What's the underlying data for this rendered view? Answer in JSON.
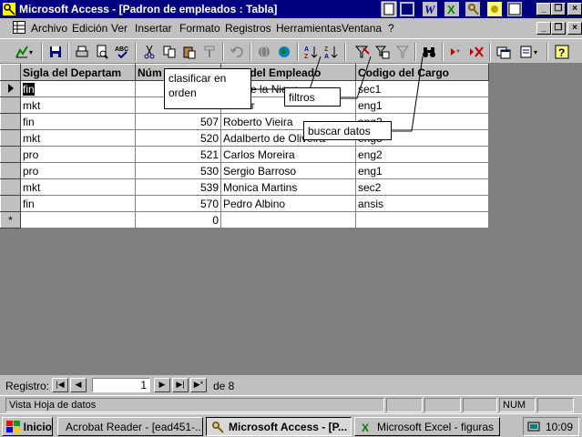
{
  "window": {
    "title": "Microsoft Access - [Padron de empleados : Tabla]"
  },
  "menu": {
    "items": [
      "Archivo",
      "Edición",
      "Ver",
      "Insertar",
      "Formato",
      "Registros",
      "Herramientas",
      "Ventana",
      "?"
    ]
  },
  "table": {
    "columns": [
      "Sigla del Departam",
      "Núm",
      "nbre del Empleado",
      "Codigo del Cargo"
    ],
    "rows": [
      [
        "fin",
        "",
        "nda de la Nieve",
        "sec1"
      ],
      [
        "mkt",
        "",
        "al Ferr",
        "eng1"
      ],
      [
        "fin",
        "507",
        "Roberto Vieira",
        "eng2"
      ],
      [
        "mkt",
        "520",
        "Adalberto de Oliveira",
        "eng3"
      ],
      [
        "pro",
        "521",
        "Carlos Moreira",
        "eng2"
      ],
      [
        "pro",
        "530",
        "Sergio Barroso",
        "eng1"
      ],
      [
        "mkt",
        "539",
        "Monica Martins",
        "sec2"
      ],
      [
        "fin",
        "570",
        "Pedro Albino",
        "ansis"
      ]
    ],
    "new_row": [
      "",
      "0",
      "",
      ""
    ],
    "new_row_marker": "*"
  },
  "callouts": {
    "sort": "clasificar en\norden",
    "filter": "filtros",
    "find": "buscar datos"
  },
  "navigator": {
    "label": "Registro:",
    "current": "1",
    "total_label": "de 8"
  },
  "status": {
    "text": "Vista Hoja de datos",
    "num": "NUM"
  },
  "taskbar": {
    "start": "Inicio",
    "tasks": [
      "Acrobat Reader - [ead451-...",
      "Microsoft Access - [P...",
      "Microsoft Excel - figuras"
    ],
    "clock": "10:09"
  }
}
